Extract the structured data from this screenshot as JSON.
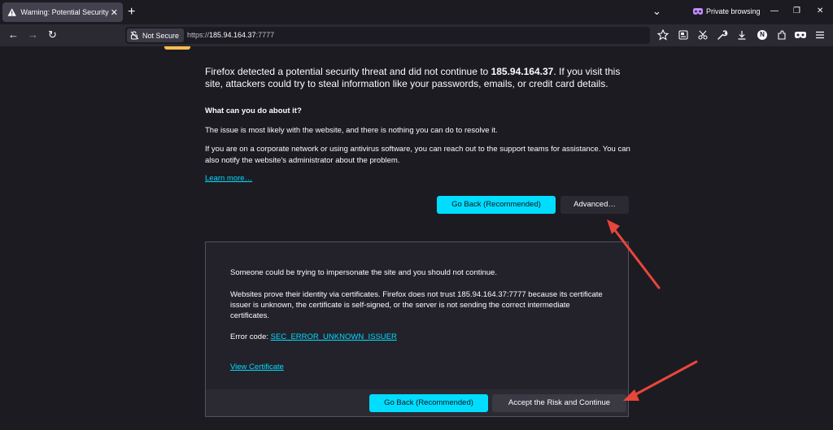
{
  "tabbar": {
    "tab_title": "Warning: Potential Security Risk Ahead",
    "tab_close": "✕",
    "new_tab": "+",
    "private_label": "Private browsing",
    "list_all_tabs": "⌄",
    "minimize": "—",
    "restore": "❐",
    "close_window": "✕"
  },
  "navbar": {
    "back": "←",
    "forward": "→",
    "reload": "↻",
    "not_secure_label": "Not Secure",
    "url_scheme": "https://",
    "url_host": "185.94.164.37",
    "url_port": ":7777",
    "account_initial": "N"
  },
  "page": {
    "intro_prefix": "Firefox detected a potential security threat and did not continue to ",
    "intro_host": "185.94.164.37",
    "intro_suffix": ". If you visit this site, attackers could try to steal information like your passwords, emails, or credit card details.",
    "heading": "What can you do about it?",
    "para1": "The issue is most likely with the website, and there is nothing you can do to resolve it.",
    "para2": "If you are on a corporate network or using antivirus software, you can reach out to the support teams for assistance. You can also notify the website's administrator about the problem.",
    "learn_more": "Learn more…",
    "go_back_label": "Go Back (Recommended)",
    "advanced_label": "Advanced…"
  },
  "advanced": {
    "para1": "Someone could be trying to impersonate the site and you should not continue.",
    "para2": "Websites prove their identity via certificates. Firefox does not trust 185.94.164.37:7777 because its certificate issuer is unknown, the certificate is self-signed, or the server is not sending the correct intermediate certificates.",
    "error_prefix": "Error code: ",
    "error_code": "SEC_ERROR_UNKNOWN_ISSUER",
    "view_certificate": "View Certificate",
    "go_back_label": "Go Back (Recommended)",
    "accept_label": "Accept the Risk and Continue"
  },
  "colors": {
    "accent": "#00ddff",
    "background": "#1c1b22",
    "annotation_arrow": "#e8463a"
  }
}
